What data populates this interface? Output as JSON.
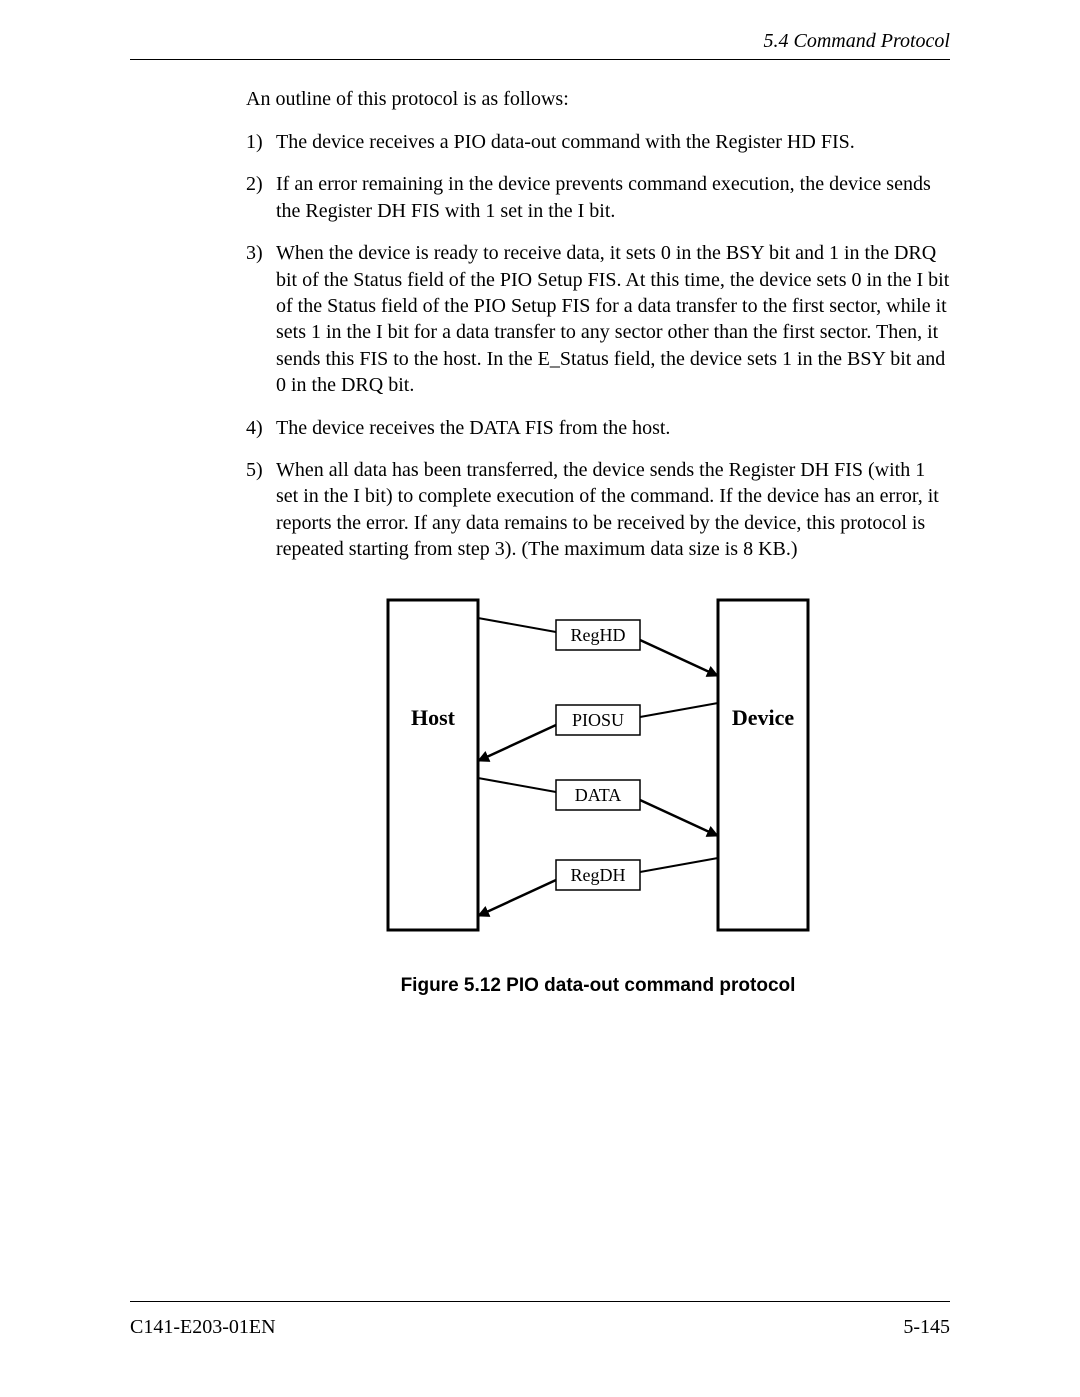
{
  "header": {
    "section": "5.4   Command Protocol"
  },
  "body": {
    "intro": "An outline of this protocol is as follows:",
    "items": [
      {
        "n": "1)",
        "t": "The device receives a PIO data-out command with the Register HD FIS."
      },
      {
        "n": "2)",
        "t": "If an error remaining in the device prevents command execution, the device sends the Register DH FIS with 1 set in the I bit."
      },
      {
        "n": "3)",
        "t": "When the device is ready to receive data, it sets 0 in the BSY bit and 1 in the DRQ bit of the Status field of the PIO Setup FIS.  At this time, the device sets 0 in the I bit of the Status field of the PIO Setup FIS for a data transfer to the first sector, while it sets 1 in the I bit for a data transfer to any sector other than the first sector.  Then, it sends this FIS to the host.  In the E_Status field, the device sets 1 in the BSY bit and 0 in the DRQ bit."
      },
      {
        "n": "4)",
        "t": "The device receives the DATA FIS from the host."
      },
      {
        "n": "5)",
        "t": "When all data has been transferred, the device sends the Register DH FIS (with 1 set in the I bit) to complete execution of the command.  If the device has an error, it reports the error.  If any data remains to be received by the device, this protocol is repeated starting from step 3).  (The maximum data size is 8 KB.)"
      }
    ]
  },
  "figure": {
    "host": "Host",
    "device": "Device",
    "msg1": "RegHD",
    "msg2": "PIOSU",
    "msg3": "DATA",
    "msg4": "RegDH",
    "caption": "Figure 5.12  PIO data-out command protocol"
  },
  "footer": {
    "doc_id": "C141-E203-01EN",
    "page_num": "5-145"
  }
}
